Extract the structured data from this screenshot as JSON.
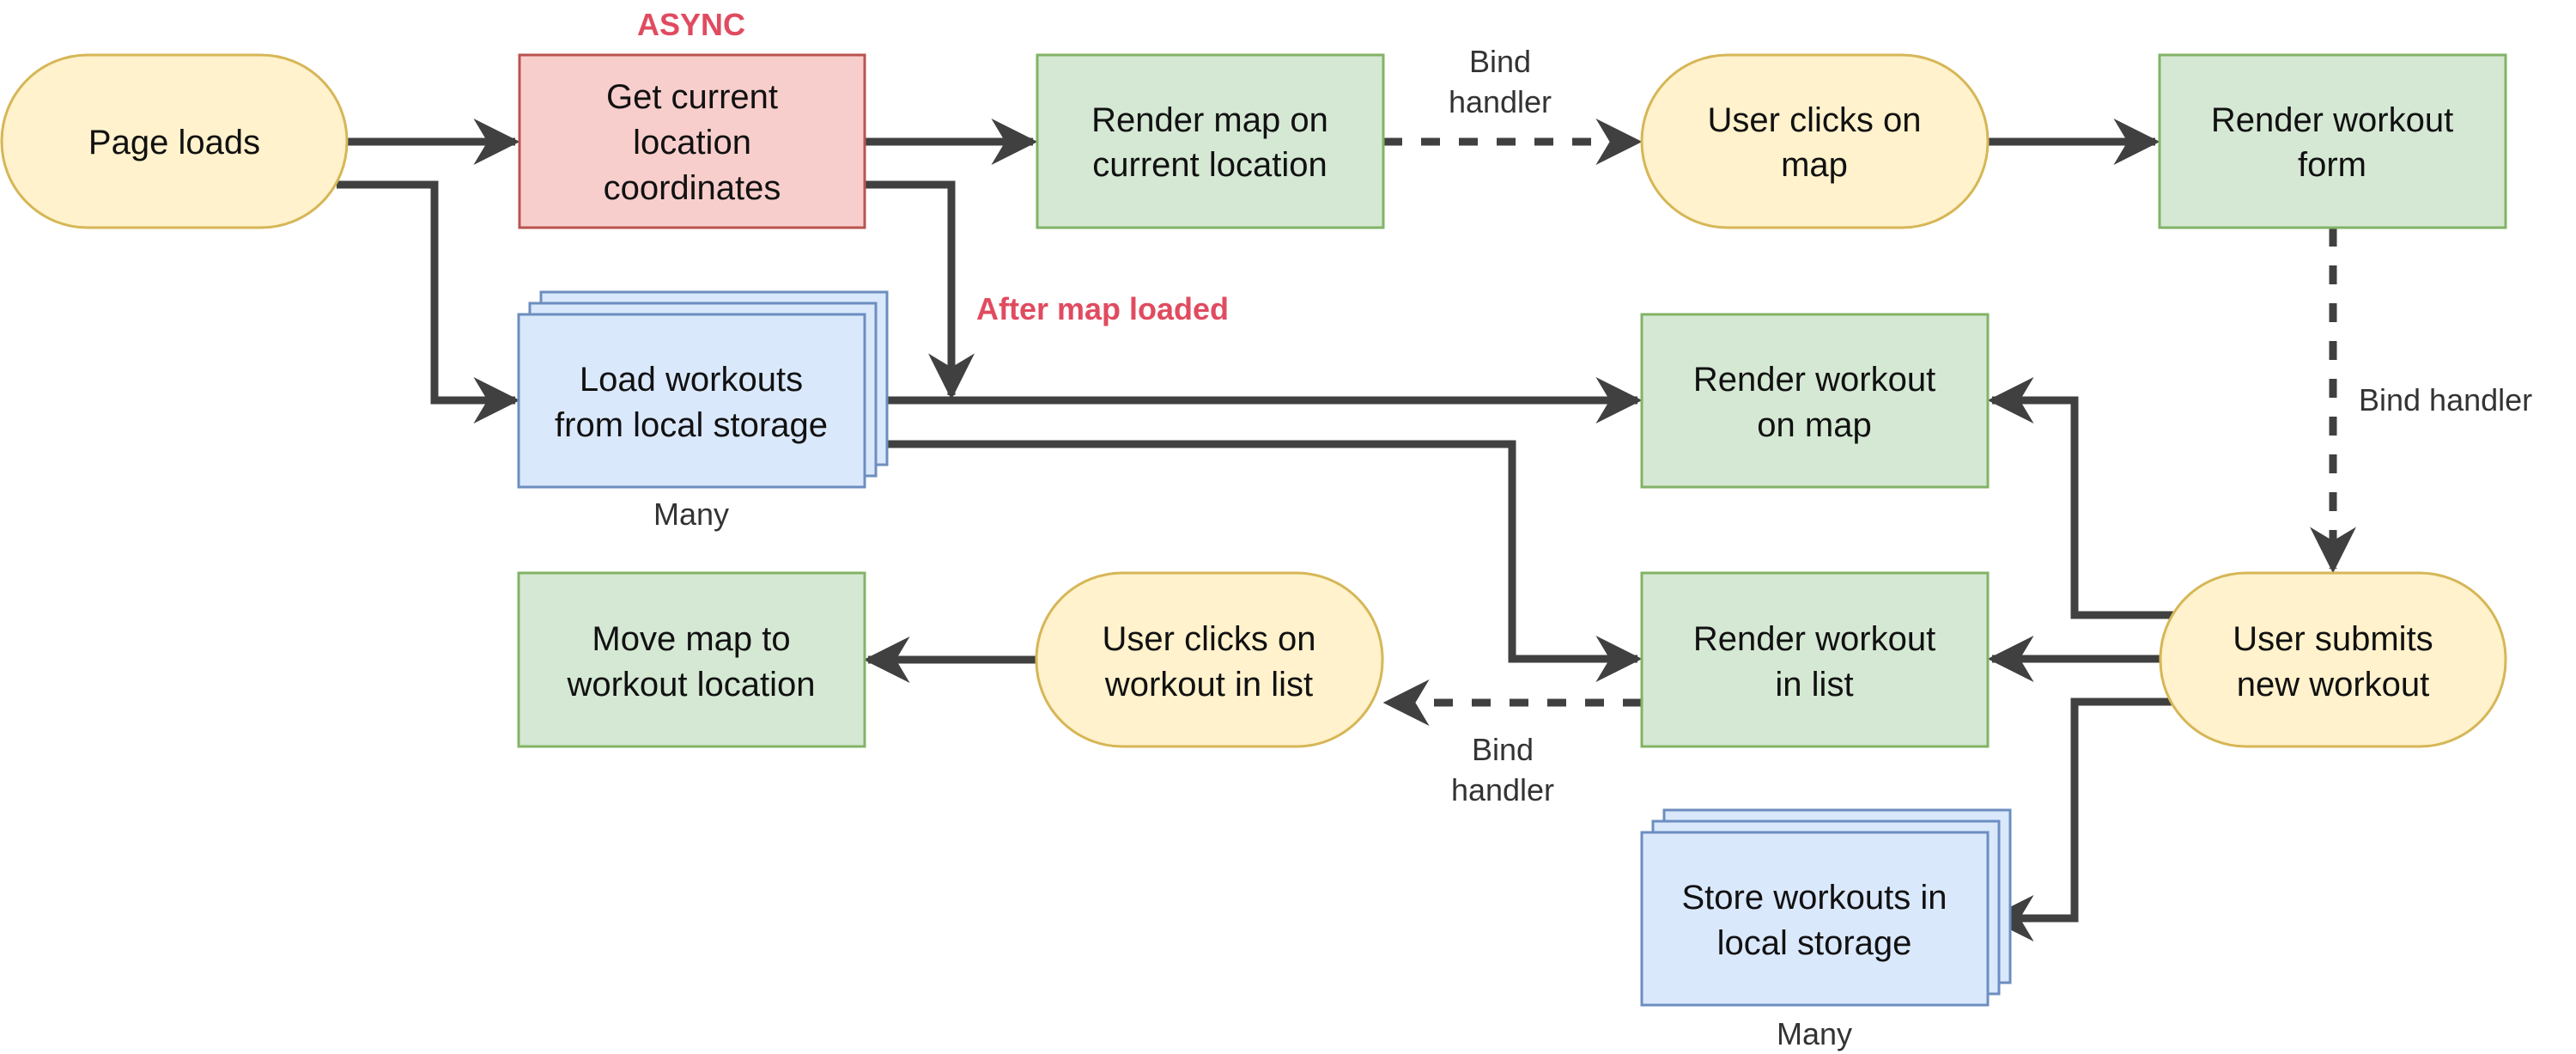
{
  "colors": {
    "terminal_fill": "#fff2cc",
    "terminal_stroke": "#d6b656",
    "process_fill": "#d5e8d4",
    "process_stroke": "#82b366",
    "async_fill": "#f8cecc",
    "async_stroke": "#b85450",
    "storage_fill": "#dae8fc",
    "storage_stroke": "#6c8ebf",
    "edge": "#404040",
    "annotation": "#e04b60"
  },
  "nodes": {
    "page_loads": {
      "type": "terminal",
      "lines": [
        "Page loads"
      ]
    },
    "get_location": {
      "type": "async",
      "lines": [
        "Get current",
        "location",
        "coordinates"
      ]
    },
    "render_map": {
      "type": "process",
      "lines": [
        "Render map on",
        "current location"
      ]
    },
    "user_clicks_map": {
      "type": "terminal",
      "lines": [
        "User clicks on",
        "map"
      ]
    },
    "render_form": {
      "type": "process",
      "lines": [
        "Render workout",
        "form"
      ]
    },
    "load_workouts": {
      "type": "storage",
      "lines": [
        "Load workouts",
        "from local storage"
      ],
      "caption": "Many"
    },
    "render_on_map": {
      "type": "process",
      "lines": [
        "Render workout",
        "on map"
      ]
    },
    "move_map": {
      "type": "process",
      "lines": [
        "Move map to",
        "workout location"
      ]
    },
    "user_clicks_list": {
      "type": "terminal",
      "lines": [
        "User clicks on",
        "workout in list"
      ]
    },
    "render_in_list": {
      "type": "process",
      "lines": [
        "Render workout",
        "in list"
      ]
    },
    "user_submits": {
      "type": "terminal",
      "lines": [
        "User submits",
        "new workout"
      ]
    },
    "store_workouts": {
      "type": "storage",
      "lines": [
        "Store workouts in",
        "local storage"
      ],
      "caption": "Many"
    }
  },
  "annotations": {
    "async": "ASYNC",
    "after_map_loaded": "After map loaded"
  },
  "edge_labels": {
    "bind_top": [
      "Bind",
      "handler"
    ],
    "bind_right": [
      "Bind handler"
    ],
    "bind_bottom": [
      "Bind",
      "handler"
    ]
  },
  "edges": [
    {
      "from": "page_loads",
      "to": "get_location",
      "style": "solid"
    },
    {
      "from": "page_loads",
      "to": "load_workouts",
      "style": "solid"
    },
    {
      "from": "get_location",
      "to": "render_map",
      "style": "solid"
    },
    {
      "from": "get_location",
      "to": "render_on_map",
      "style": "solid",
      "label": "After map loaded"
    },
    {
      "from": "render_map",
      "to": "user_clicks_map",
      "style": "dashed",
      "label": "Bind handler"
    },
    {
      "from": "user_clicks_map",
      "to": "render_form",
      "style": "solid"
    },
    {
      "from": "render_form",
      "to": "user_submits",
      "style": "dashed",
      "label": "Bind handler"
    },
    {
      "from": "load_workouts",
      "to": "render_on_map",
      "style": "solid"
    },
    {
      "from": "load_workouts",
      "to": "render_in_list",
      "style": "solid"
    },
    {
      "from": "user_submits",
      "to": "render_on_map",
      "style": "solid"
    },
    {
      "from": "user_submits",
      "to": "render_in_list",
      "style": "solid"
    },
    {
      "from": "user_submits",
      "to": "store_workouts",
      "style": "solid"
    },
    {
      "from": "render_in_list",
      "to": "user_clicks_list",
      "style": "dashed",
      "label": "Bind handler"
    },
    {
      "from": "user_clicks_list",
      "to": "move_map",
      "style": "solid"
    }
  ]
}
